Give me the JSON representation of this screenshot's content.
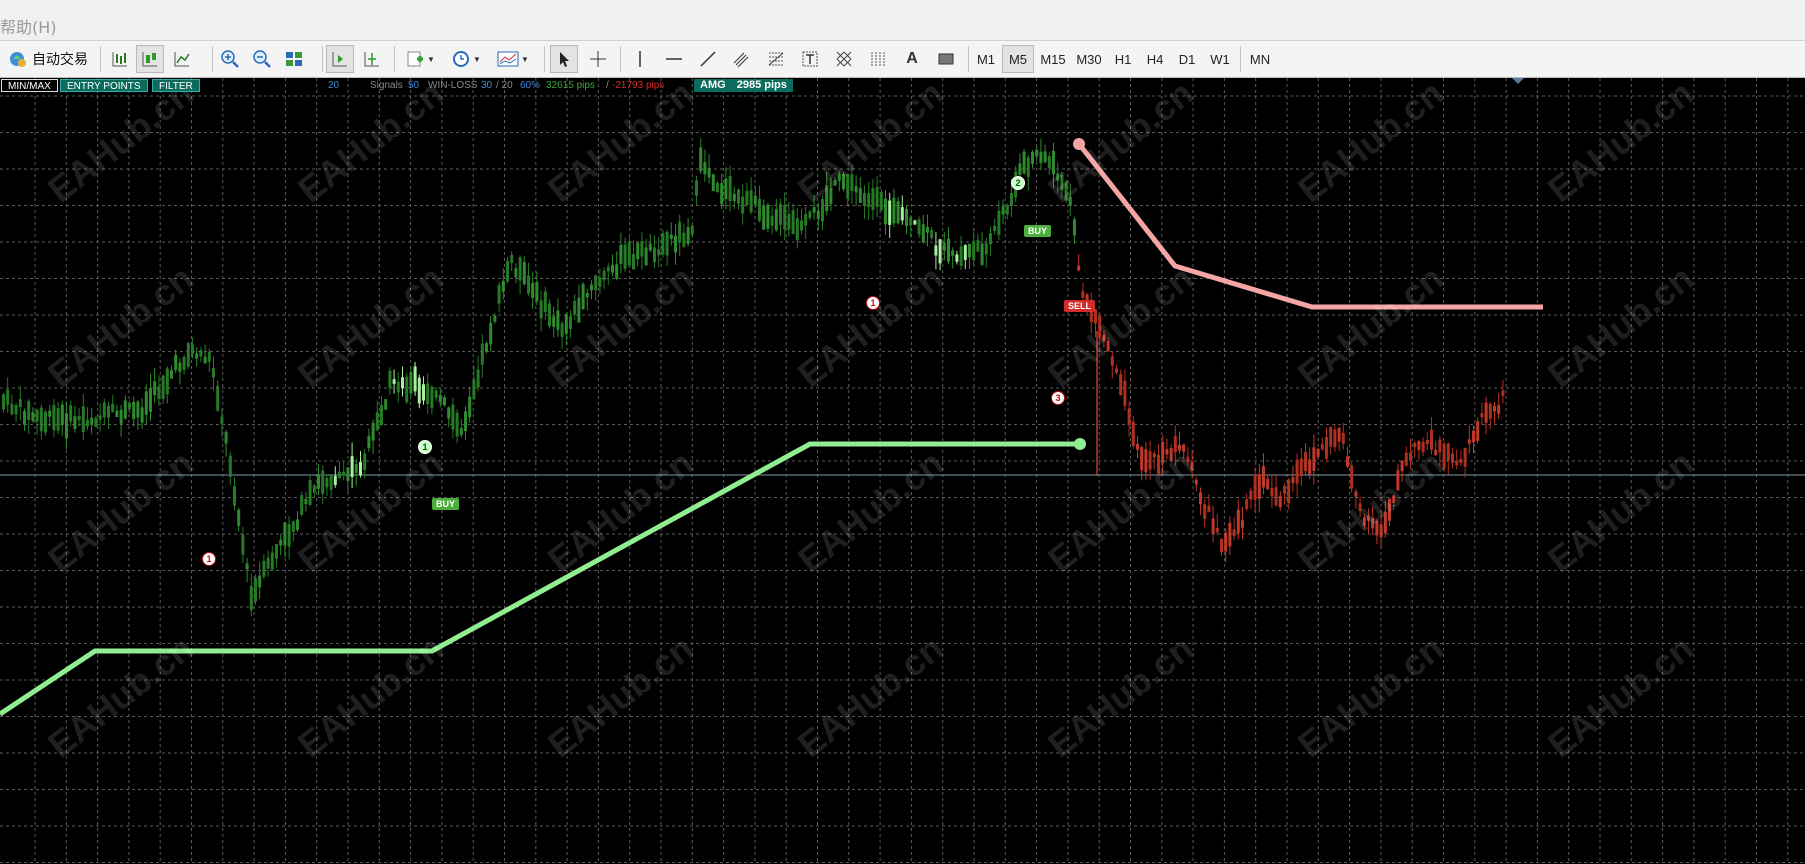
{
  "menubar": {
    "text": "帮助(H)"
  },
  "toolbar": {
    "autotrade_label": "自动交易",
    "timeframes": [
      "M1",
      "M5",
      "M15",
      "M30",
      "H1",
      "H4",
      "D1",
      "W1",
      "MN"
    ],
    "active_timeframe": "M5",
    "text_tool_label": "A"
  },
  "panel": {
    "minmax_label": "MIN/MAX",
    "entry_points_label": "ENTRY POINTS",
    "filter_label": "FILTER",
    "count": "20",
    "signals_label": "Signals",
    "signals_value": "50",
    "winloss_label": "WIN-LOSS",
    "win_value": "30",
    "loss_value": "/ 20",
    "percent_value": "60%",
    "win_pips": "32615 pips",
    "separator": "/",
    "loss_pips": "-21793 pips",
    "amg_label": "AMG",
    "amg_value": "2985 pips"
  },
  "signals": [
    {
      "type": "BUY",
      "label": "BUY"
    },
    {
      "type": "BUY",
      "label": "BUY"
    },
    {
      "type": "SELL",
      "label": "SELL"
    }
  ],
  "markers": [
    "1",
    "1",
    "1",
    "2",
    "3"
  ],
  "watermark": "EAHub.cn",
  "colors": {
    "bg": "#000000",
    "grid": "#5a5a5a",
    "bull_band": "#90ee90",
    "bear_band": "#f4a6a6",
    "green_candle": "#2e8b2e",
    "red_candle": "#c0392b",
    "buy": "#4cae3c",
    "sell": "#d42a2a"
  }
}
